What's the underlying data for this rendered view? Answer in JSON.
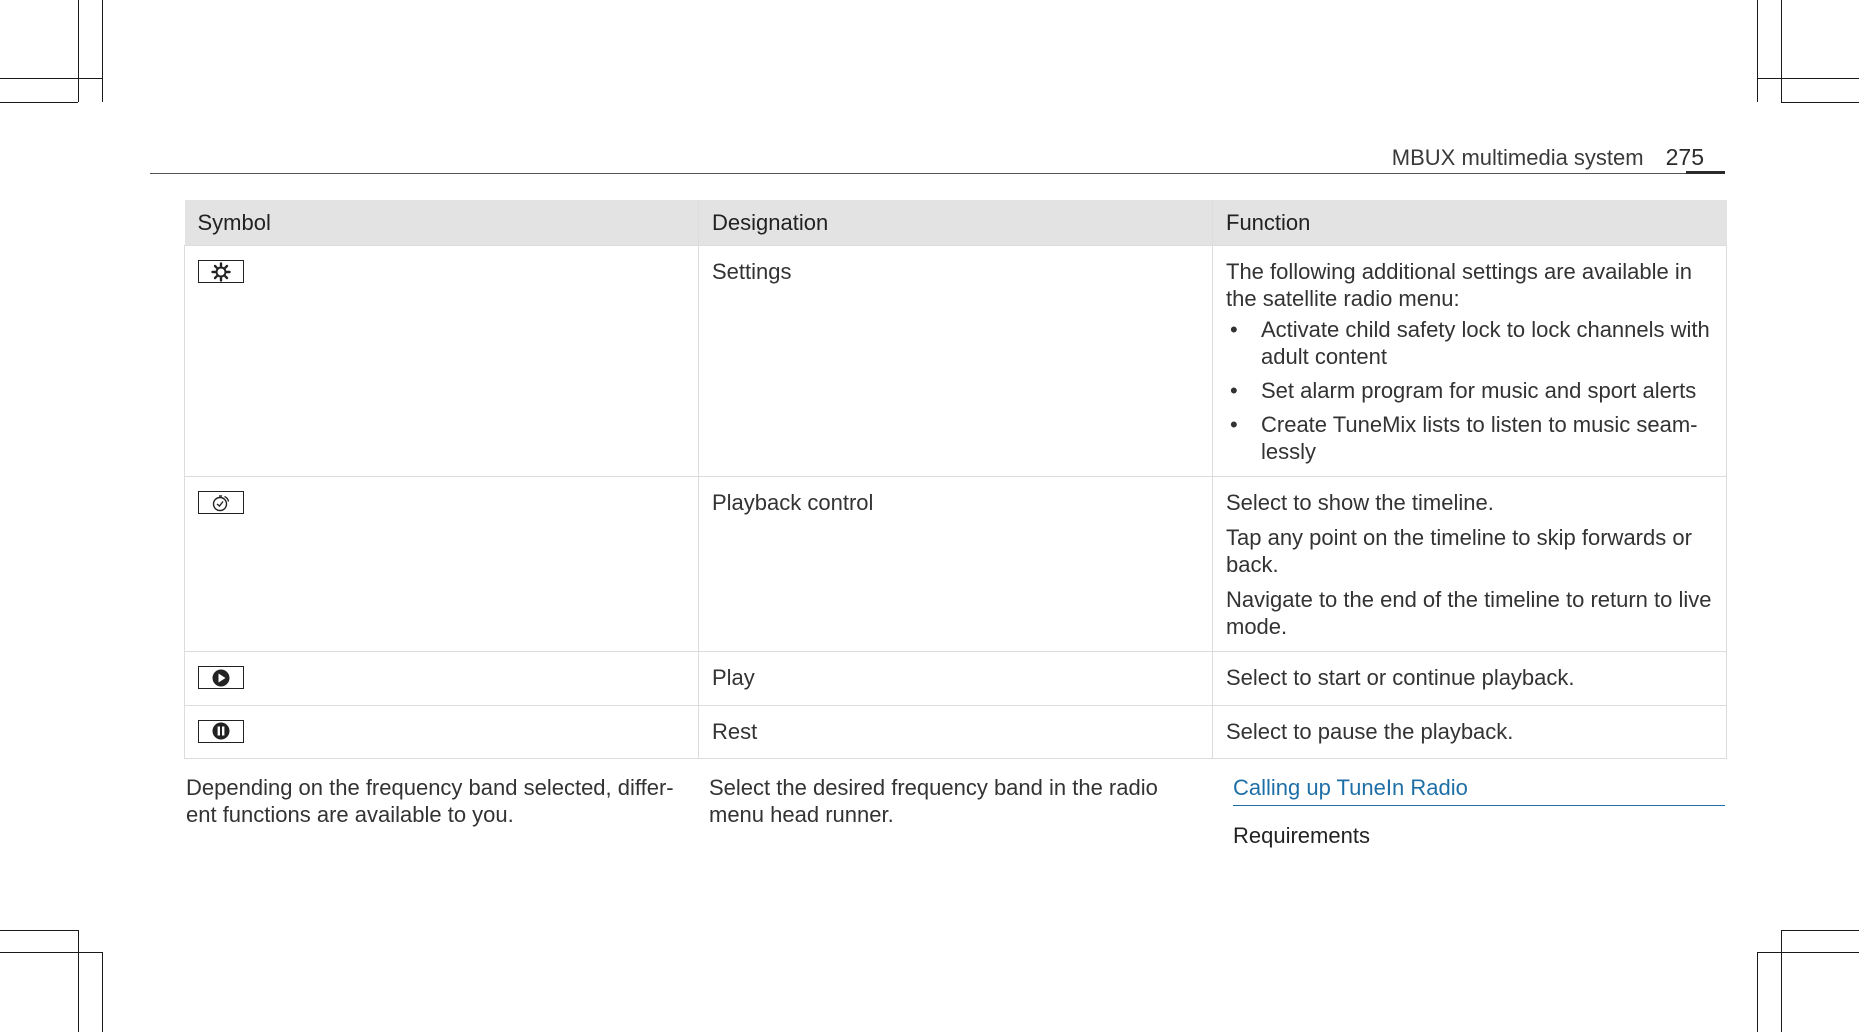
{
  "header": {
    "section_title": "MBUX multimedia system",
    "page_number": "275"
  },
  "table": {
    "headers": [
      "Symbol",
      "Designation",
      "Function"
    ],
    "rows": [
      {
        "icon": "gear-icon",
        "designation": "Settings",
        "function_intro": "The following additional settings are available in the satellite radio menu:",
        "function_items": [
          "Activate child safety lock to lock channels with adult content",
          "Set alarm program for music and sport alerts",
          "Create TuneMix lists to listen to music seam-lessly"
        ]
      },
      {
        "icon": "timer-icon",
        "designation": "Playback control",
        "function_paragraphs": [
          "Select to show the timeline.",
          "Tap any point on the timeline to skip forwards or back.",
          "Navigate to the end of the timeline to return to live mode."
        ]
      },
      {
        "icon": "play-icon",
        "designation": "Play",
        "function": "Select to start or continue playback."
      },
      {
        "icon": "pause-icon",
        "designation": "Rest",
        "function": "Select to pause the playback."
      }
    ]
  },
  "body": {
    "col1_text": "Depending on the frequency band selected, differ-ent functions are available to you.",
    "col2_text": "Select the desired frequency band in the radio menu head runner.",
    "section_link": "Calling up TuneIn Radio",
    "requirements_label": "Requirements"
  },
  "colors": {
    "link": "#1f6fa7",
    "table_header_bg": "#e3e3e3"
  }
}
